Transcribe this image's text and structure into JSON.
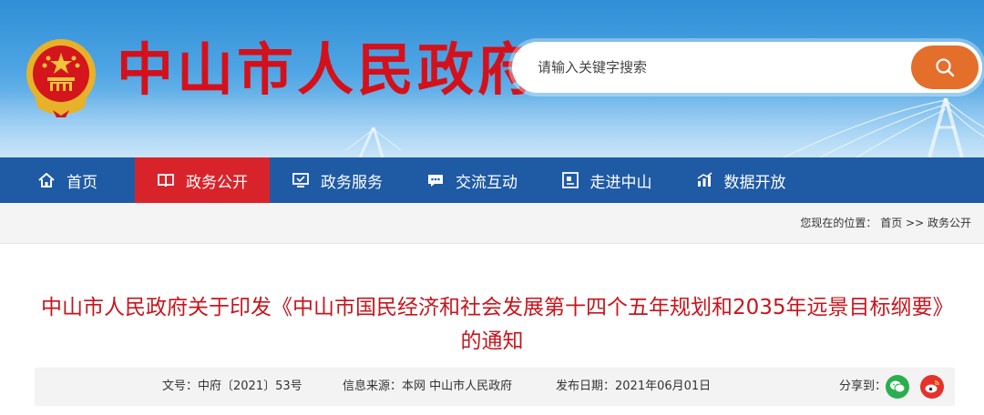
{
  "header": {
    "site_title": "中山市人民政府",
    "search": {
      "placeholder": "请输入关键字搜索"
    }
  },
  "nav": {
    "items": [
      {
        "label": "首页",
        "icon": "home-icon"
      },
      {
        "label": "政务公开",
        "icon": "book-icon",
        "active": true
      },
      {
        "label": "政务服务",
        "icon": "monitor-icon"
      },
      {
        "label": "交流互动",
        "icon": "chat-icon"
      },
      {
        "label": "走进中山",
        "icon": "picture-icon"
      },
      {
        "label": "数据开放",
        "icon": "bar-chart-icon"
      }
    ]
  },
  "breadcrumb": {
    "prefix": "您现在的位置：",
    "items": [
      "首页",
      "政务公开"
    ],
    "separator": ">>"
  },
  "article": {
    "title": "中山市人民政府关于印发《中山市国民经济和社会发展第十四个五年规划和2035年远景目标纲要》的通知",
    "doc_no": "文号：中府〔2021〕53号",
    "source": "信息来源：本网 中山市人民政府",
    "date": "发布日期：2021年06月01日",
    "share_label": "分享到："
  },
  "colors": {
    "brand_red": "#d4111b",
    "nav_blue": "#1f5aa4",
    "nav_active": "#d9232b",
    "search_button": "#e36f2a",
    "wechat_green": "#2aae4f",
    "weibo_red": "#e5322d"
  }
}
